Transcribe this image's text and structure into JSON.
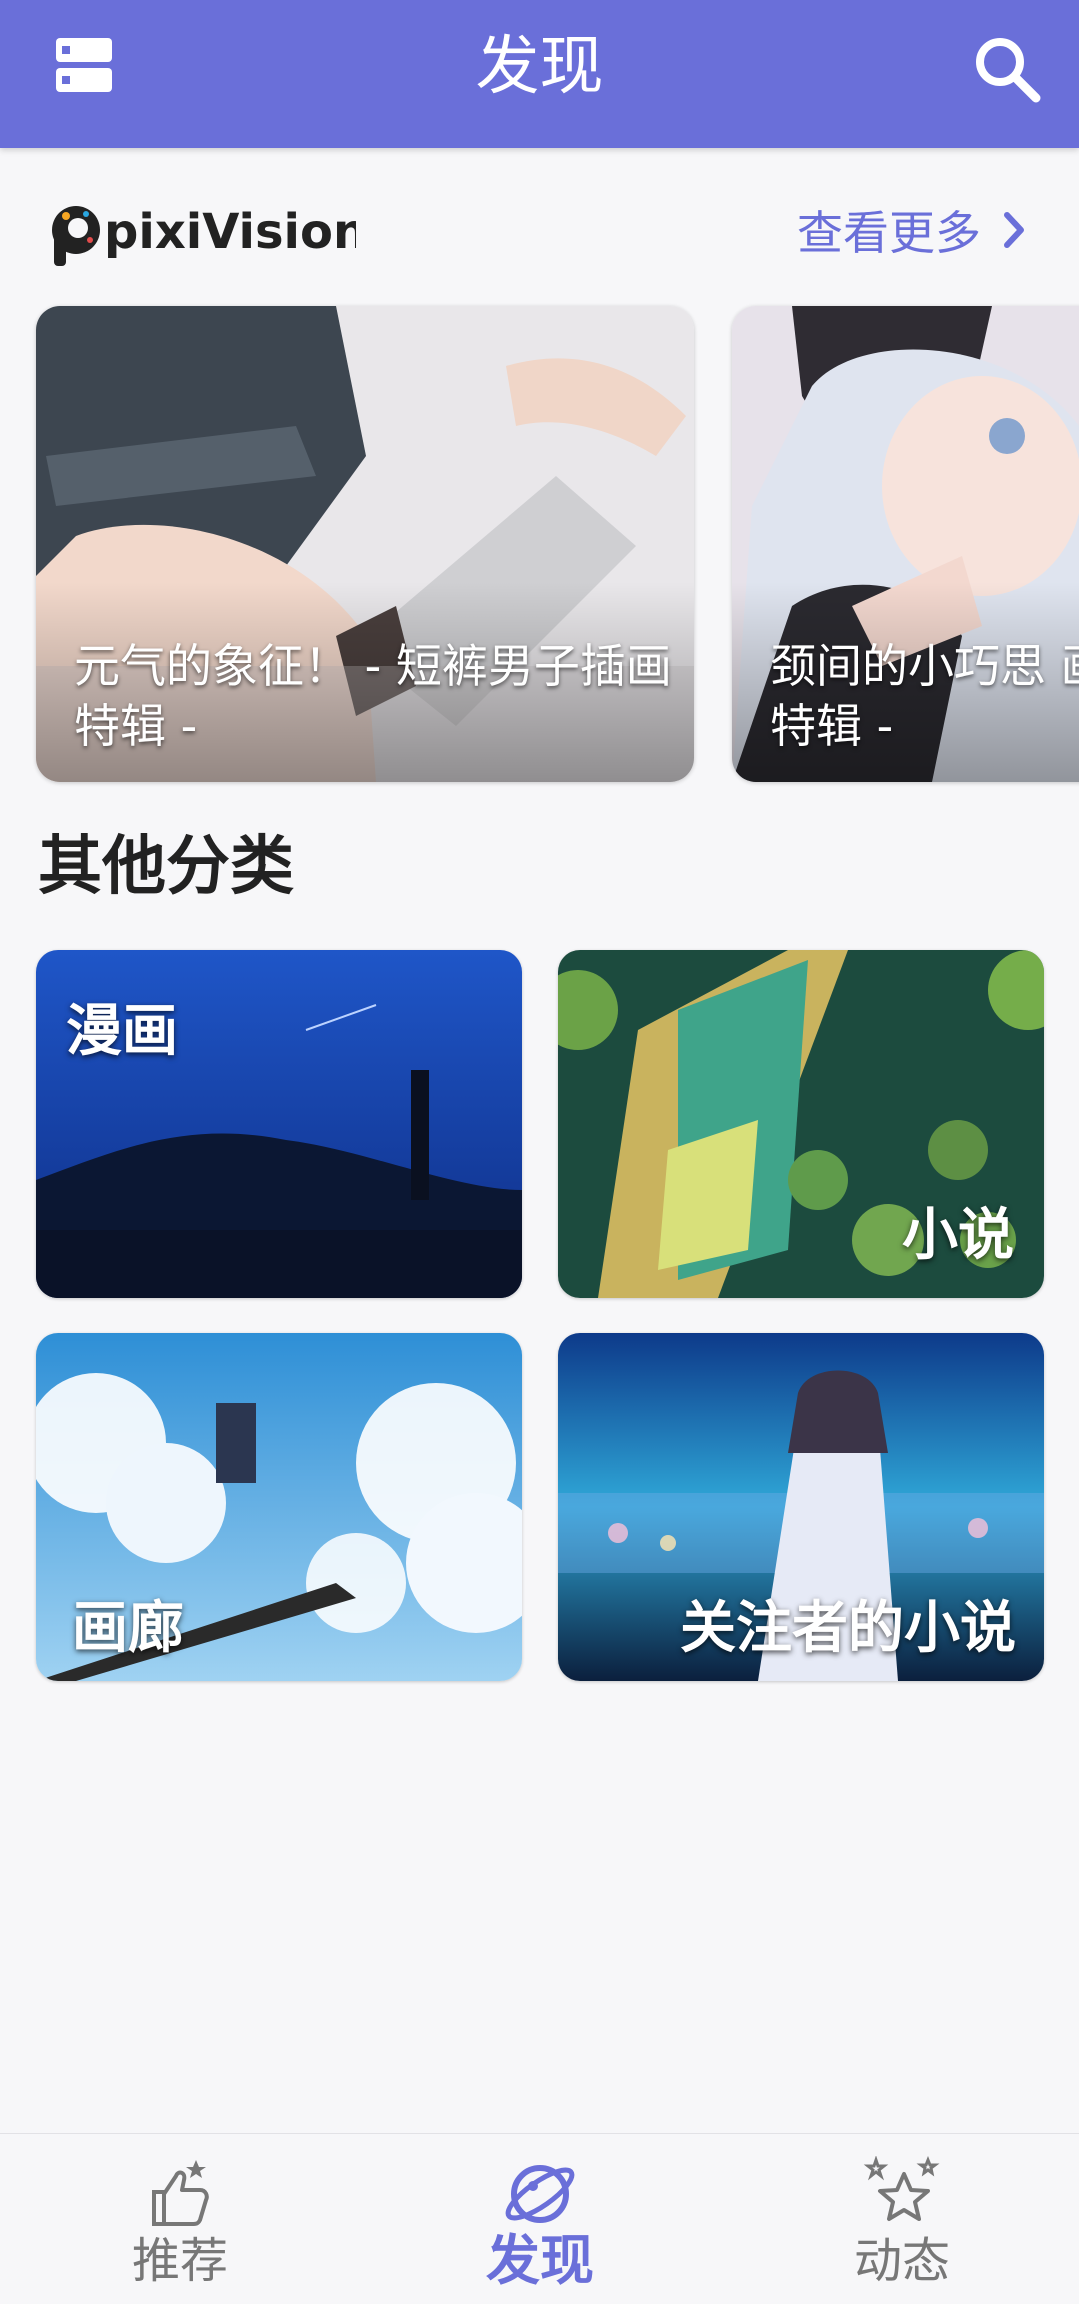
{
  "appbar": {
    "title": "发现"
  },
  "pixivision": {
    "logo_text": "pixiVision",
    "more_label": "查看更多"
  },
  "articles": [
    {
      "title": "元气的象征！ - 短裤男子插画特辑 -"
    },
    {
      "title": "颈间的小巧思 画特辑 -"
    }
  ],
  "other": {
    "heading": "其他分类",
    "tiles": [
      {
        "label": "漫画"
      },
      {
        "label": "小说"
      },
      {
        "label": "画廊"
      },
      {
        "label": "关注者的小说"
      }
    ]
  },
  "nav": {
    "items": [
      {
        "label": "推荐",
        "icon": "thumbs-up-icon"
      },
      {
        "label": "发现",
        "icon": "planet-icon"
      },
      {
        "label": "动态",
        "icon": "stars-icon"
      }
    ]
  },
  "colors": {
    "accent": "#6a6fd9",
    "background": "#f7f7f9"
  }
}
